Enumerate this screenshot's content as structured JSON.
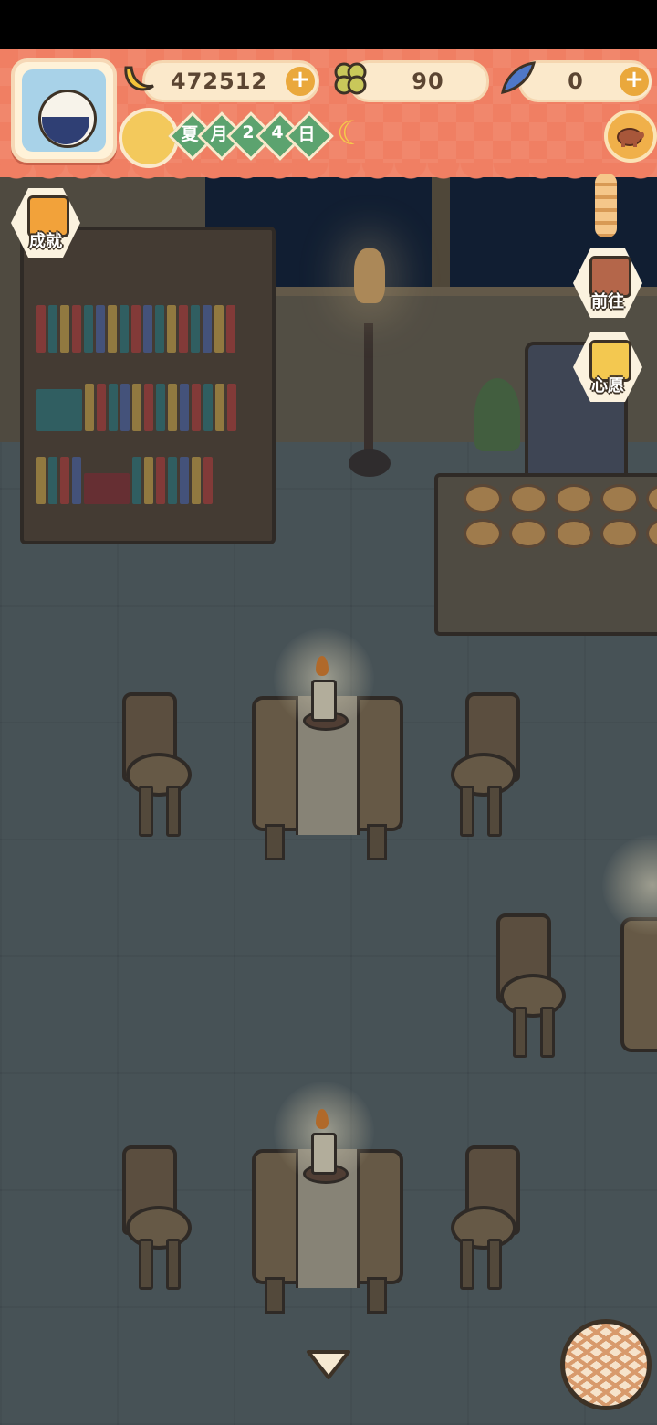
{
  "hud": {
    "bananas": {
      "value": "472512",
      "icon": "banana-icon"
    },
    "clovers": {
      "value": "90",
      "icon": "clover-icon"
    },
    "gems": {
      "value": "0",
      "icon": "blue-feather-icon"
    },
    "date": {
      "season": "夏",
      "month_label": "月",
      "day_digit_1": "2",
      "day_digit_2": "4",
      "day_label": "日"
    },
    "time_icon": "moon-icon"
  },
  "side_buttons": {
    "achievements": {
      "label": "成就",
      "icon": "clipboard-icon"
    },
    "goto": {
      "label": "前往",
      "icon": "map-board-icon"
    },
    "wish": {
      "label": "心愿",
      "icon": "wish-book-icon"
    }
  },
  "colors": {
    "hud_bg": "#f07f63",
    "pill_bg": "#fbe9cb",
    "date_green": "#5ca36f",
    "plus_orange": "#eaa83c"
  }
}
